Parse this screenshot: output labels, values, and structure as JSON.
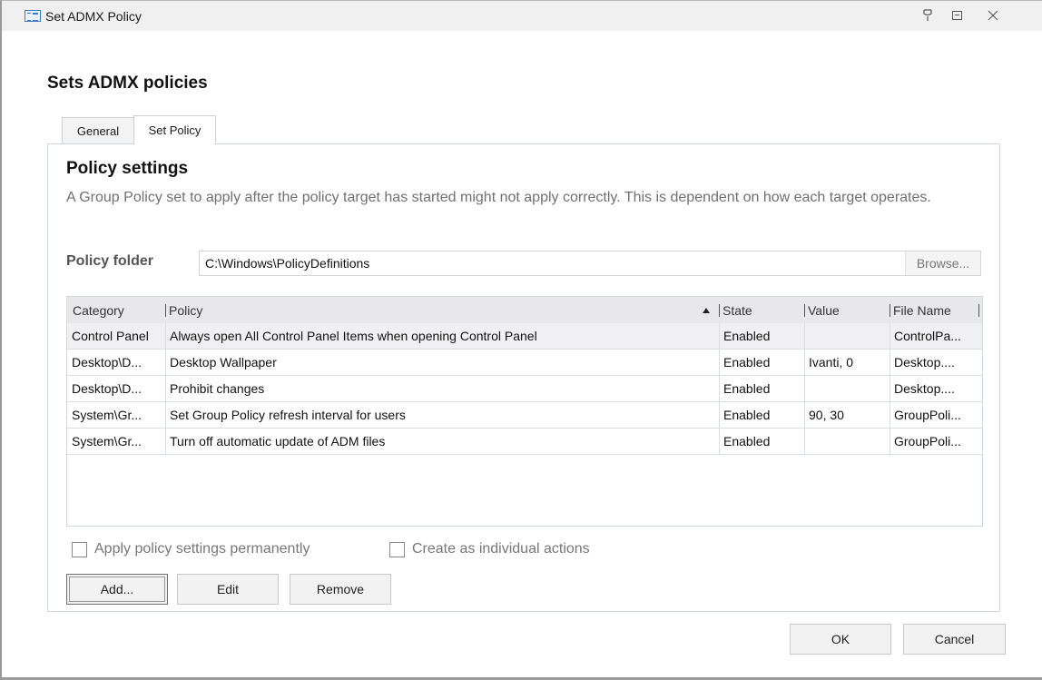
{
  "window": {
    "title": "Set ADMX Policy"
  },
  "dialog": {
    "heading": "Sets ADMX policies"
  },
  "tabs": [
    {
      "label": "General",
      "active": false
    },
    {
      "label": "Set Policy",
      "active": true
    }
  ],
  "panel": {
    "section_title": "Policy settings",
    "description": "A Group Policy set to apply after the policy target has started might not apply correctly. This is dependent on how each target operates.",
    "folder_label": "Policy folder",
    "folder_value": "C:\\Windows\\PolicyDefinitions",
    "browse_label": "Browse...",
    "columns": [
      "Category",
      "Policy",
      "State",
      "Value",
      "File Name"
    ],
    "sort_column": "Policy",
    "sort_direction": "ascending",
    "rows": [
      {
        "category": "Control Panel",
        "policy": "Always open All Control Panel Items when opening Control Panel",
        "state": "Enabled",
        "value": "",
        "file": "ControlPa..."
      },
      {
        "category": "Desktop\\D...",
        "policy": "Desktop Wallpaper",
        "state": "Enabled",
        "value": "Ivanti, 0",
        "file": "Desktop...."
      },
      {
        "category": "Desktop\\D...",
        "policy": "Prohibit changes",
        "state": "Enabled",
        "value": "",
        "file": "Desktop...."
      },
      {
        "category": "System\\Gr...",
        "policy": "Set Group Policy refresh interval for users",
        "state": "Enabled",
        "value": "90, 30",
        "file": "GroupPoli..."
      },
      {
        "category": "System\\Gr...",
        "policy": "Turn off automatic update of ADM files",
        "state": "Enabled",
        "value": "",
        "file": "GroupPoli..."
      }
    ],
    "checkbox_permanent": {
      "label": "Apply policy settings permanently",
      "checked": false,
      "enabled": false
    },
    "checkbox_individual": {
      "label": "Create as individual actions",
      "checked": false,
      "enabled": false
    },
    "add_label": "Add...",
    "edit_label": "Edit",
    "remove_label": "Remove"
  },
  "footer": {
    "ok_label": "OK",
    "cancel_label": "Cancel"
  }
}
